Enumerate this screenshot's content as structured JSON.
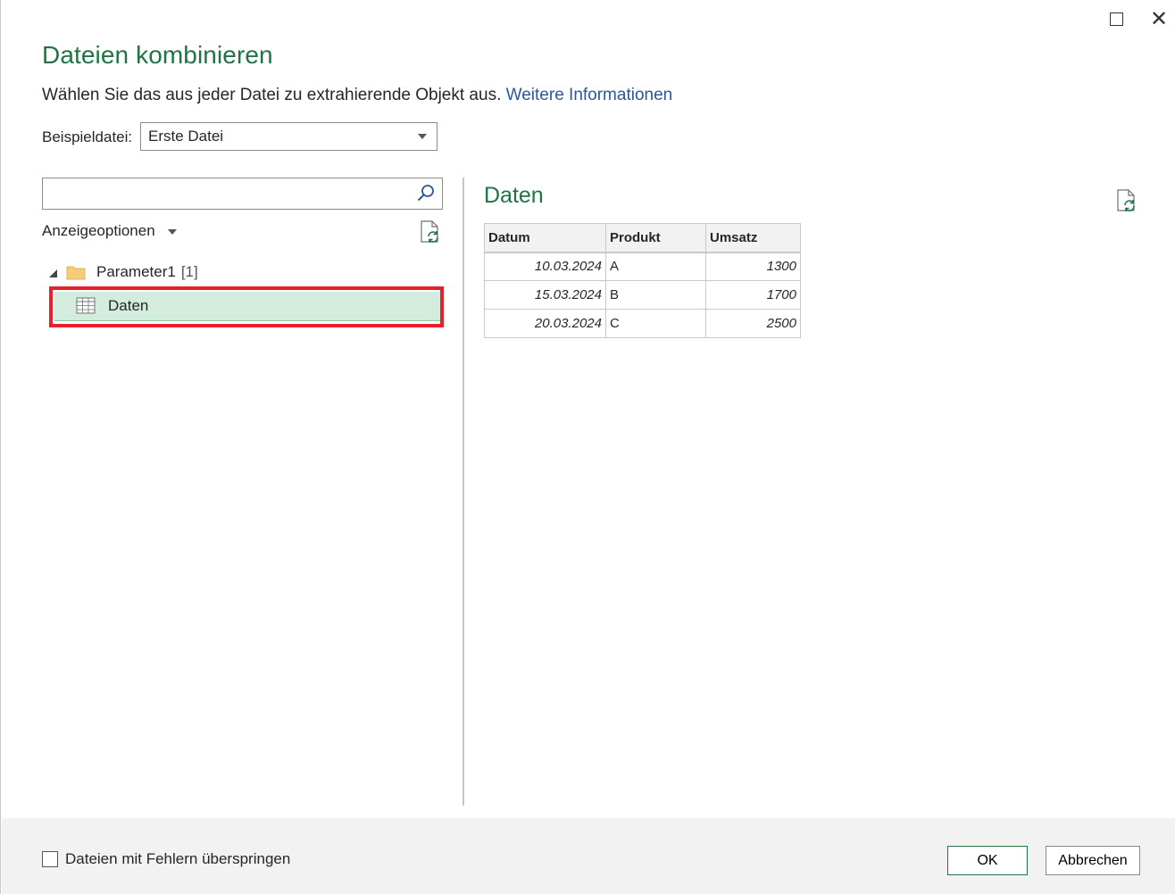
{
  "window": {
    "maximize_icon": "maximize-icon",
    "close_icon": "close-icon"
  },
  "dialog": {
    "title": "Dateien kombinieren",
    "subtitle": "Wählen Sie das aus jeder Datei zu extrahierende Objekt aus.",
    "more_info_link": "Weitere Informationen"
  },
  "sample_file": {
    "label": "Beispieldatei:",
    "selected": "Erste Datei"
  },
  "navigator": {
    "search": {
      "value": "",
      "icon": "search-icon"
    },
    "display_options_label": "Anzeigeoptionen",
    "refresh_icon": "refresh-document-icon",
    "tree": {
      "folder_name": "Parameter1",
      "folder_count": "[1]",
      "folder_icon": "folder-icon",
      "item_label": "Daten",
      "item_icon": "table-icon",
      "item_selected": true
    }
  },
  "preview": {
    "title": "Daten",
    "refresh_icon": "refresh-document-icon",
    "columns": [
      "Datum",
      "Produkt",
      "Umsatz"
    ],
    "rows": [
      [
        "10.03.2024",
        "A",
        "1300"
      ],
      [
        "15.03.2024",
        "B",
        "1700"
      ],
      [
        "20.03.2024",
        "C",
        "2500"
      ]
    ]
  },
  "footer": {
    "skip_errors_label": "Dateien mit Fehlern überspringen",
    "skip_errors_checked": false,
    "ok_label": "OK",
    "cancel_label": "Abbrechen"
  },
  "colors": {
    "accent_green": "#217346",
    "link_blue": "#2b579a",
    "selection_bg": "#d3ecde",
    "highlight_red": "#e8202a",
    "footer_bg": "#f2f2f2"
  }
}
